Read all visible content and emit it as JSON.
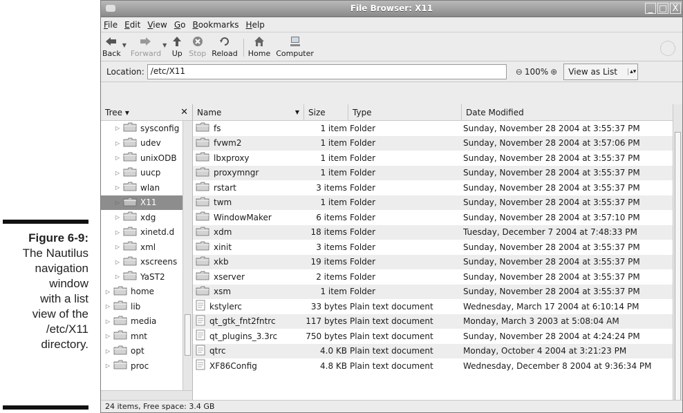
{
  "caption": {
    "figure": "Figure 6-9:",
    "lines": [
      "The Nautilus",
      "navigation",
      "window",
      "with a list",
      "view of the",
      "/etc/X11",
      "directory."
    ]
  },
  "window": {
    "title": "File Browser: X11",
    "controls": [
      "_",
      "□",
      "X"
    ]
  },
  "menu": [
    "File",
    "Edit",
    "View",
    "Go",
    "Bookmarks",
    "Help"
  ],
  "toolbar": {
    "back": "Back",
    "forward": "Forward",
    "up": "Up",
    "stop": "Stop",
    "reload": "Reload",
    "home": "Home",
    "computer": "Computer"
  },
  "location": {
    "label": "Location:",
    "value": "/etc/X11",
    "zoom": "100%",
    "view": "View as List"
  },
  "sidebar": {
    "title": "Tree",
    "nodes": [
      {
        "name": "sysconfig",
        "indent": 1
      },
      {
        "name": "udev",
        "indent": 1
      },
      {
        "name": "unixODB",
        "indent": 1
      },
      {
        "name": "uucp",
        "indent": 1
      },
      {
        "name": "wlan",
        "indent": 1
      },
      {
        "name": "X11",
        "indent": 1,
        "selected": true
      },
      {
        "name": "xdg",
        "indent": 1
      },
      {
        "name": "xinetd.d",
        "indent": 1
      },
      {
        "name": "xml",
        "indent": 1
      },
      {
        "name": "xscreens",
        "indent": 1
      },
      {
        "name": "YaST2",
        "indent": 1
      },
      {
        "name": "home",
        "indent": 0
      },
      {
        "name": "lib",
        "indent": 0
      },
      {
        "name": "media",
        "indent": 0
      },
      {
        "name": "mnt",
        "indent": 0
      },
      {
        "name": "opt",
        "indent": 0
      },
      {
        "name": "proc",
        "indent": 0
      }
    ]
  },
  "columns": [
    "Name",
    "Size",
    "Type",
    "Date Modified"
  ],
  "files": [
    {
      "name": "fs",
      "size": "1 item",
      "type": "Folder",
      "date": "Sunday, November 28 2004 at 3:55:37 PM",
      "icon": "folder"
    },
    {
      "name": "fvwm2",
      "size": "1 item",
      "type": "Folder",
      "date": "Sunday, November 28 2004 at 3:57:06 PM",
      "icon": "folder"
    },
    {
      "name": "lbxproxy",
      "size": "1 item",
      "type": "Folder",
      "date": "Sunday, November 28 2004 at 3:55:37 PM",
      "icon": "folder"
    },
    {
      "name": "proxymngr",
      "size": "1 item",
      "type": "Folder",
      "date": "Sunday, November 28 2004 at 3:55:37 PM",
      "icon": "folder"
    },
    {
      "name": "rstart",
      "size": "3 items",
      "type": "Folder",
      "date": "Sunday, November 28 2004 at 3:55:37 PM",
      "icon": "folder"
    },
    {
      "name": "twm",
      "size": "1 item",
      "type": "Folder",
      "date": "Sunday, November 28 2004 at 3:55:37 PM",
      "icon": "folder"
    },
    {
      "name": "WindowMaker",
      "size": "6 items",
      "type": "Folder",
      "date": "Sunday, November 28 2004 at 3:57:10 PM",
      "icon": "folder"
    },
    {
      "name": "xdm",
      "size": "18 items",
      "type": "Folder",
      "date": "Tuesday, December 7 2004 at 7:48:33 PM",
      "icon": "folder"
    },
    {
      "name": "xinit",
      "size": "3 items",
      "type": "Folder",
      "date": "Sunday, November 28 2004 at 3:55:37 PM",
      "icon": "folder"
    },
    {
      "name": "xkb",
      "size": "19 items",
      "type": "Folder",
      "date": "Sunday, November 28 2004 at 3:55:37 PM",
      "icon": "folder"
    },
    {
      "name": "xserver",
      "size": "2 items",
      "type": "Folder",
      "date": "Sunday, November 28 2004 at 3:55:37 PM",
      "icon": "folder"
    },
    {
      "name": "xsm",
      "size": "1 item",
      "type": "Folder",
      "date": "Sunday, November 28 2004 at 3:55:37 PM",
      "icon": "folder"
    },
    {
      "name": "kstylerc",
      "size": "33 bytes",
      "type": "Plain text document",
      "date": "Wednesday, March 17 2004 at 6:10:14 PM",
      "icon": "text"
    },
    {
      "name": "qt_gtk_fnt2fntrc",
      "size": "117 bytes",
      "type": "Plain text document",
      "date": "Monday, March 3 2003 at 5:08:04 AM",
      "icon": "text"
    },
    {
      "name": "qt_plugins_3.3rc",
      "size": "750 bytes",
      "type": "Plain text document",
      "date": "Sunday, November 28 2004 at 4:24:24 PM",
      "icon": "text"
    },
    {
      "name": "qtrc",
      "size": "4.0 KB",
      "type": "Plain text document",
      "date": "Monday, October 4 2004 at 3:21:23 PM",
      "icon": "text"
    },
    {
      "name": "XF86Config",
      "size": "4.8 KB",
      "type": "Plain text document",
      "date": "Wednesday, December 8 2004 at 9:36:34 PM",
      "icon": "text"
    }
  ],
  "status": "24 items, Free space: 3.4 GB"
}
